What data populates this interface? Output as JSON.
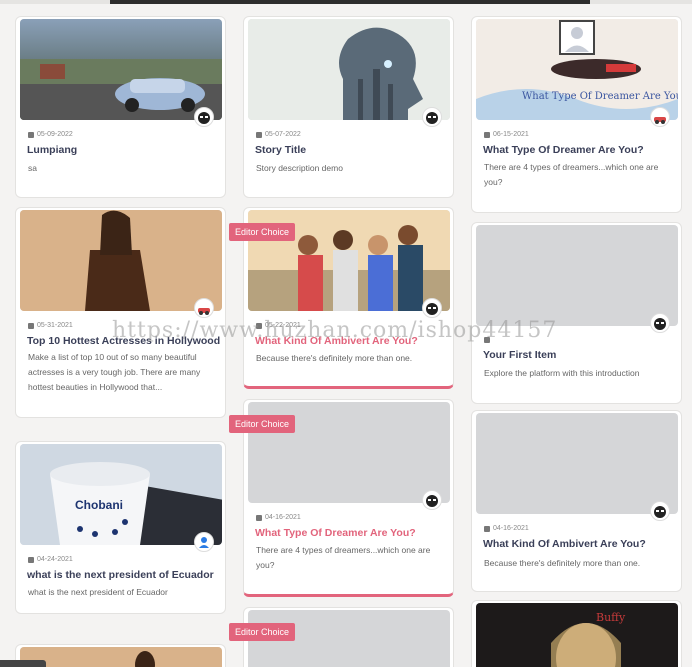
{
  "cards": [
    {
      "id": "lumpiang",
      "date": "05-09-2022",
      "title": "Lumpiang",
      "desc": "sa"
    },
    {
      "id": "story-title",
      "date": "05-07-2022",
      "title": "Story Title",
      "desc": "Story description demo"
    },
    {
      "id": "dreamer-1",
      "date": "06-15-2021",
      "title": "What Type Of Dreamer Are You?",
      "desc": "There are 4 types of dreamers...which one are you?"
    },
    {
      "id": "actresses",
      "date": "05-31-2021",
      "title": "Top 10 Hottest Actresses in Hollywood",
      "desc": "Make a list of top 10 out of so many beautiful actresses is a very tough job. There are many hottest beauties in Hollywood that..."
    },
    {
      "id": "ambivert-1",
      "date": "05-22-2021",
      "title": "What Kind Of Ambivert Are You?",
      "desc": "Because there's definitely more than one."
    },
    {
      "id": "first-item",
      "date": "",
      "title": "Your First Item",
      "desc": "Explore the platform with this introduction"
    },
    {
      "id": "ecuador",
      "date": "04-24-2021",
      "title": "what is the next president of Ecuador",
      "desc": "what is the next president of Ecuador"
    },
    {
      "id": "dreamer-2",
      "date": "04-16-2021",
      "title": "What Type Of Dreamer Are You?",
      "desc": "There are 4 types of dreamers...which one are you?"
    },
    {
      "id": "ambivert-2",
      "date": "04-16-2021",
      "title": "What Kind Of Ambivert Are You?",
      "desc": "Because there's definitely more than one."
    }
  ],
  "badge_label": "Editor Choice",
  "thumb_text": {
    "dreamer_title": "What Type Of Dreamer Are You?",
    "yogurt_brand": "Chobani",
    "buffy_title": "Buffy"
  },
  "watermark": "https://www.huzhan.com/ishop44157",
  "colors": {
    "accent": "#e2647c",
    "title": "#3a3f58",
    "background": "#f4f3f2"
  }
}
